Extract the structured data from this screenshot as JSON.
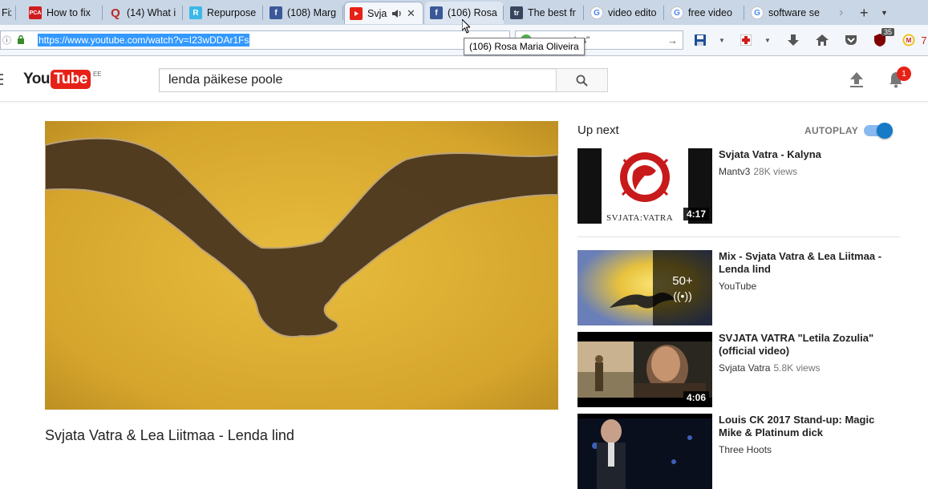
{
  "browser": {
    "tabs": [
      {
        "label": "Fix",
        "favicon": "none"
      },
      {
        "label": "How to fix",
        "favicon": "PCA"
      },
      {
        "label": "(14) What i",
        "favicon": "Q"
      },
      {
        "label": "Repurpose",
        "favicon": "R"
      },
      {
        "label": "(108) Marg",
        "favicon": "f"
      },
      {
        "label": "Svja",
        "favicon": "youtube"
      },
      {
        "label": "(106) Rosa",
        "favicon": "f"
      },
      {
        "label": "The best fr",
        "favicon": "tr"
      },
      {
        "label": "video edito",
        "favicon": "G"
      },
      {
        "label": "free video",
        "favicon": "G"
      },
      {
        "label": "software se",
        "favicon": "G"
      }
    ],
    "tooltip": "(106) Rosa Maria Oliveira",
    "url": "https://www.youtube.com/watch?v=I23wDDAr1Fs",
    "search_text": "glas\"",
    "ublock_count": "35",
    "extra_count": "7"
  },
  "youtube": {
    "logo_you": "You",
    "logo_tube": "Tube",
    "country": "EE",
    "search_query": "lenda päikese poole",
    "notification_count": "1"
  },
  "video": {
    "title": "Svjata Vatra & Lea Liitmaa - Lenda lind"
  },
  "sidebar": {
    "up_next_label": "Up next",
    "autoplay_label": "AUTOPLAY",
    "autoplay_on": true,
    "recommendations": [
      {
        "title": "Svjata Vatra - Kalyna",
        "channel": "Mantv3",
        "views": "28K views",
        "duration": "4:17",
        "thumb_text": "SVJATA:VATRA"
      },
      {
        "title": "Mix - Svjata Vatra & Lea Liitmaa - Lenda lind",
        "channel": "YouTube",
        "views": "",
        "count": "50+"
      },
      {
        "title": "SVJATA VATRA \"Letila Zozulia\" (official video)",
        "channel": "Svjata Vatra",
        "views": "5.8K views",
        "duration": "4:06"
      },
      {
        "title": "Louis CK 2017 Stand-up: Magic Mike & Platinum dick",
        "channel": "Three Hoots",
        "views": ""
      }
    ]
  },
  "colors": {
    "youtube_red": "#e62117",
    "autoplay_blue": "#167ac6",
    "url_highlight": "#3399ff"
  }
}
